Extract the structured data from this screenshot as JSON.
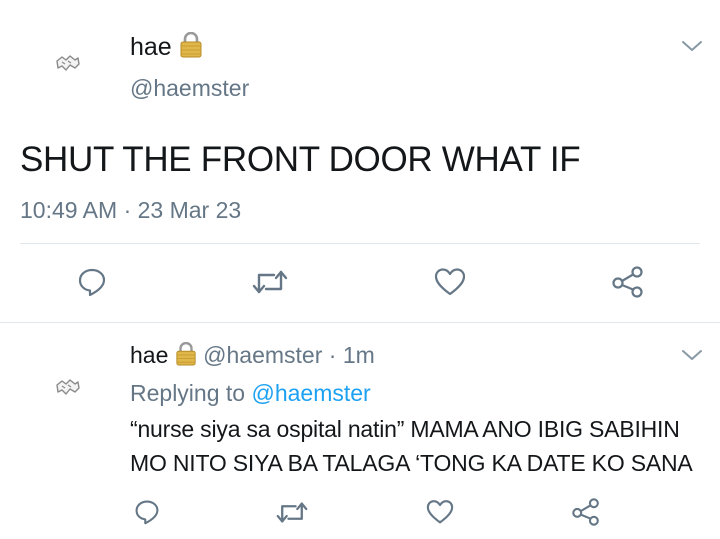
{
  "tweet": {
    "display_name": "hae",
    "handle": "@haemster",
    "text": "SHUT THE FRONT DOOR WHAT IF",
    "timestamp": "10:49 AM · 23 Mar 23",
    "lock_icon": "lock-icon",
    "menu_icon": "chevron-down-icon"
  },
  "actions": {
    "reply_icon": "reply-icon",
    "retweet_icon": "retweet-icon",
    "like_icon": "heart-icon",
    "share_icon": "share-icon"
  },
  "reply": {
    "display_name": "hae",
    "handle": "@haemster",
    "separator": " · ",
    "time": "1m",
    "replying_to_label": "Replying to",
    "replying_to_handle": "@haemster",
    "text_line1": "“nurse siya sa ospital natin” MAMA ANO IBIG SABIHIN",
    "text_line2": "MO NITO SIYA BA TALAGA ‘TONG KA DATE KO SANA"
  },
  "colors": {
    "text": "#14171a",
    "secondary": "#657786",
    "accent": "#1da1f2",
    "divider": "#e1e8ed"
  }
}
